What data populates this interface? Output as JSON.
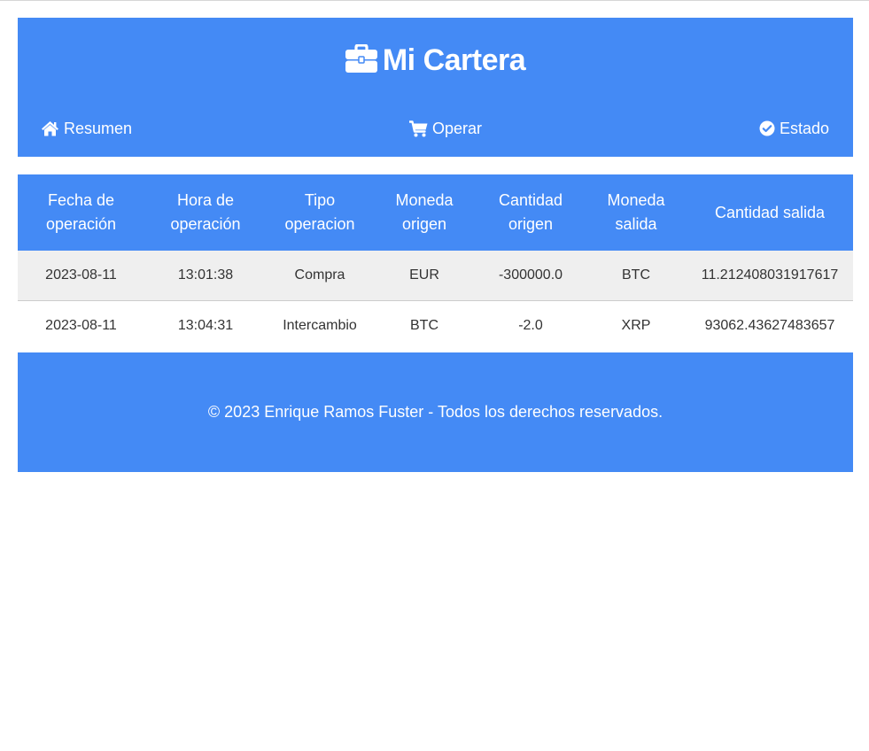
{
  "header": {
    "title": "Mi Cartera",
    "title_icon": "briefcase-icon"
  },
  "nav": {
    "items": [
      {
        "label": "Resumen",
        "icon": "home-icon"
      },
      {
        "label": "Operar",
        "icon": "shopping-cart-icon"
      },
      {
        "label": "Estado",
        "icon": "check-circle-icon"
      }
    ]
  },
  "table": {
    "headers": [
      [
        "Fecha de",
        "operación"
      ],
      [
        "Hora de",
        "operación"
      ],
      [
        "Tipo",
        "operacion"
      ],
      [
        "Moneda",
        "origen"
      ],
      [
        "Cantidad",
        "origen"
      ],
      [
        "Moneda",
        "salida"
      ],
      [
        "Cantidad salida"
      ]
    ],
    "rows": [
      [
        "2023-08-11",
        "13:01:38",
        "Compra",
        "EUR",
        "-300000.0",
        "BTC",
        "11.212408031917617"
      ],
      [
        "2023-08-11",
        "13:04:31",
        "Intercambio",
        "BTC",
        "-2.0",
        "XRP",
        "93062.43627483657"
      ]
    ]
  },
  "footer": {
    "text": "© 2023 Enrique Ramos Fuster - Todos los derechos reservados."
  },
  "colors": {
    "primary": "#448af5",
    "row_alt": "#efefef",
    "text": "#333333"
  }
}
